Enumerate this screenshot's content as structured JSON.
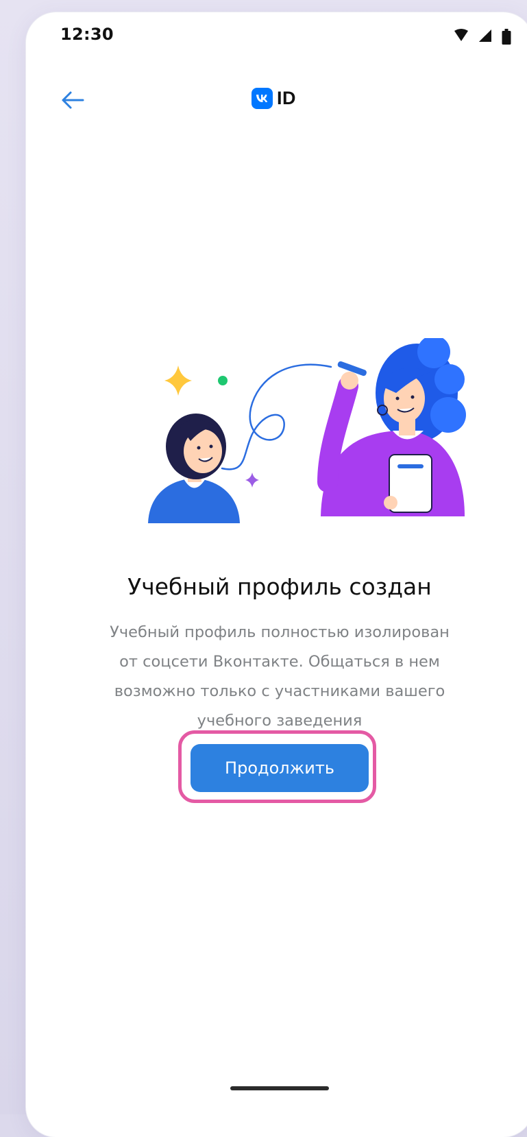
{
  "status_bar": {
    "time": "12:30",
    "icons": [
      "wifi-icon",
      "signal-icon",
      "battery-icon"
    ]
  },
  "header": {
    "back_icon": "arrow-left-icon",
    "logo_mark": "vk-logo-icon",
    "logo_text": "ID"
  },
  "illustration": {
    "description_icons": [
      "sparkle-icon",
      "teacher-illustration",
      "student-illustration"
    ]
  },
  "content": {
    "title": "Учебный профиль создан",
    "description_lines": [
      "Учебный профиль полностью изолирован",
      "от соцсети Вконтакте. Общаться в нем",
      "возможно только с участниками вашего",
      "учебного заведения"
    ]
  },
  "actions": {
    "continue_label": "Продолжить"
  },
  "colors": {
    "accent": "#2d81e0",
    "highlight": "#e45aa4",
    "vk_blue": "#0077ff",
    "text_primary": "#111111",
    "text_secondary": "#7f8285"
  }
}
